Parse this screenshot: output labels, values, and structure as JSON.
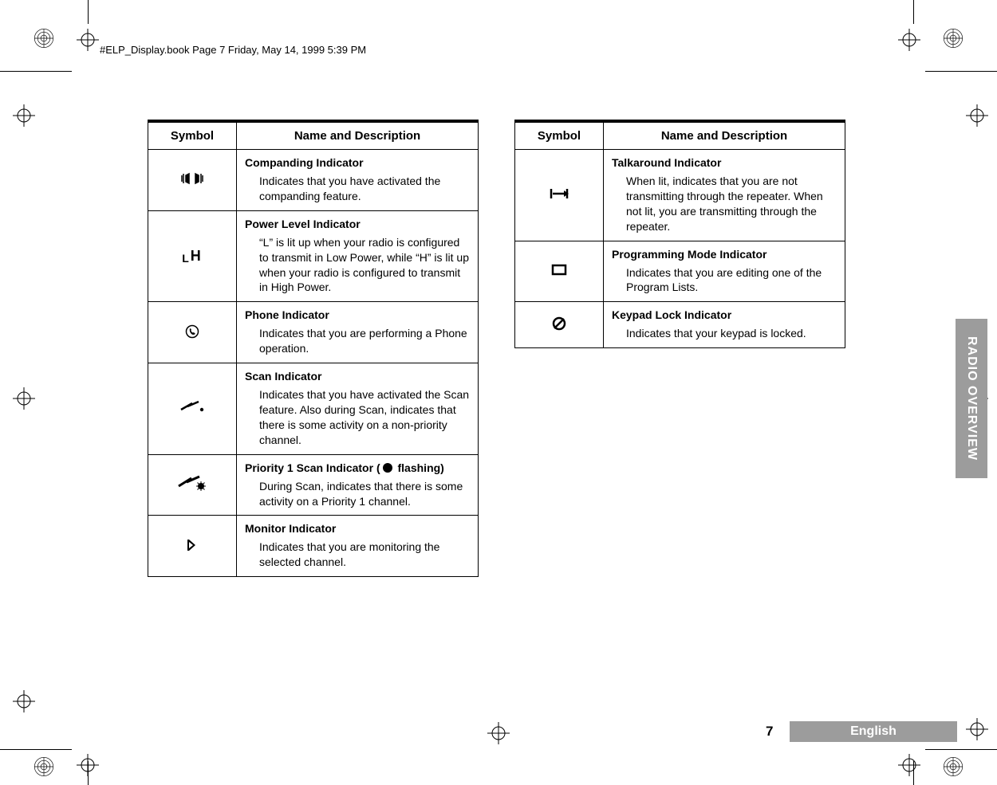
{
  "header": "#ELP_Display.book  Page 7  Friday, May 14, 1999  5:39 PM",
  "page_number": "7",
  "language_label": "English",
  "side_tab": "RADIO OVERVIEW",
  "table_headers": {
    "symbol": "Symbol",
    "desc": "Name and Description"
  },
  "left_rows": [
    {
      "title": "Companding Indicator",
      "body": "Indicates that you have activated the companding feature."
    },
    {
      "title": "Power Level Indicator",
      "body": "“L” is lit up when your radio is configured to transmit in Low Power, while “H” is lit up when your radio is configured to transmit in High Power."
    },
    {
      "title": "Phone Indicator",
      "body": "Indicates that you are performing a Phone operation."
    },
    {
      "title": "Scan Indicator",
      "body": "Indicates that you have activated the Scan feature. Also during Scan, indicates that there is some activity on a non-priority channel."
    },
    {
      "title_prefix": "Priority 1 Scan Indicator (",
      "title_suffix": "flashing)",
      "body": "During Scan, indicates that there is some activity on a Priority 1 channel."
    },
    {
      "title": "Monitor Indicator",
      "body": "Indicates that you are monitoring the selected channel."
    }
  ],
  "right_rows": [
    {
      "title": "Talkaround Indicator",
      "body": "When lit, indicates that you are not transmitting through the repeater. When not lit, you are transmitting through the repeater."
    },
    {
      "title": "Programming Mode Indicator",
      "body": "Indicates that you are editing one of the Program Lists."
    },
    {
      "title": "Keypad Lock Indicator",
      "body": "Indicates that your keypad is locked."
    }
  ]
}
